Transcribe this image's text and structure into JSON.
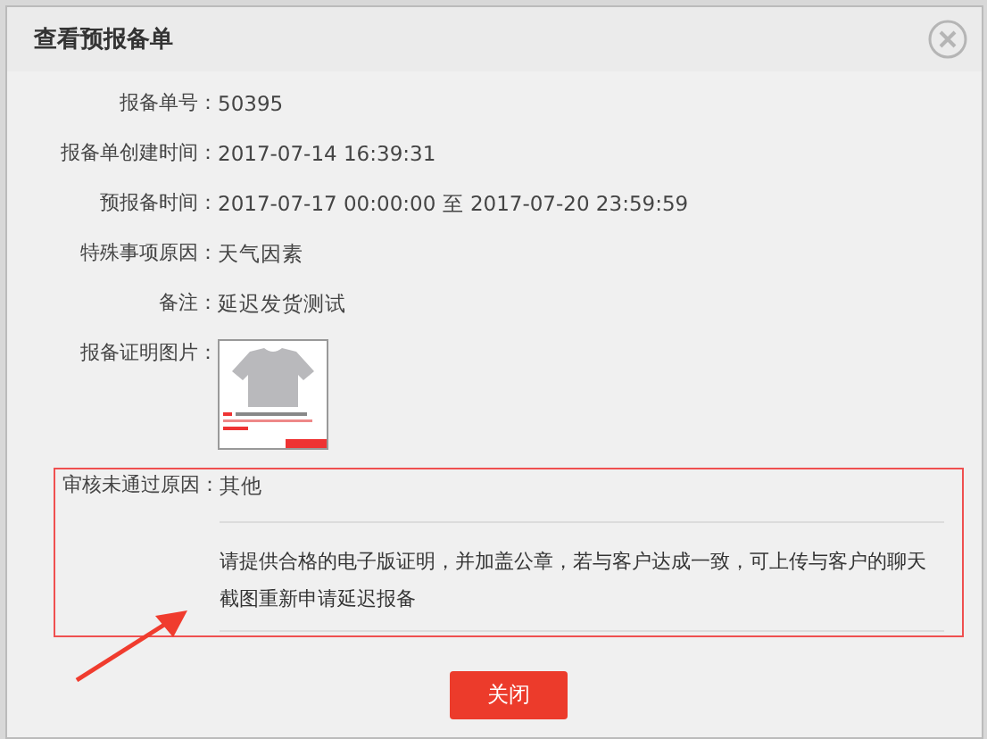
{
  "dialog": {
    "title": "查看预报备单"
  },
  "fields": [
    {
      "label": "报备单号：",
      "value": "50395"
    },
    {
      "label": "报备单创建时间：",
      "value": "2017-07-14 16:39:31"
    },
    {
      "label": "预报备时间：",
      "value": "2017-07-17 00:00:00 至 2017-07-20 23:59:59"
    },
    {
      "label": "特殊事项原因：",
      "value": "天气因素"
    },
    {
      "label": "备注：",
      "value": "延迟发货测试"
    }
  ],
  "proof_image": {
    "label": "报备证明图片："
  },
  "rejection": {
    "label": "审核未通过原因：",
    "reason": "其他",
    "comment": "请提供合格的电子版证明，并加盖公章，若与客户达成一致，可上传与客户的聊天截图重新申请延迟报备"
  },
  "buttons": [
    {
      "label": "关闭"
    }
  ]
}
